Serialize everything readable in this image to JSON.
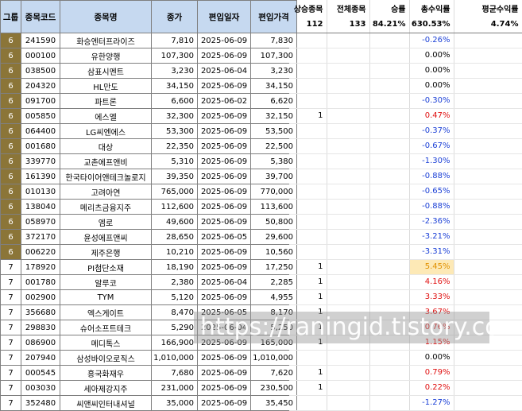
{
  "headers": [
    "그룹",
    "종목코드",
    "종목명",
    "종가",
    "편입일자",
    "편입가격"
  ],
  "rows": [
    {
      "group": "6",
      "code": "241590",
      "name": "화승엔터프라이즈",
      "close": "7,810",
      "date": "2025-06-09",
      "price": "7,830"
    },
    {
      "group": "6",
      "code": "000100",
      "name": "유한양행",
      "close": "107,300",
      "date": "2025-06-09",
      "price": "107,300"
    },
    {
      "group": "6",
      "code": "038500",
      "name": "삼표시멘트",
      "close": "3,230",
      "date": "2025-06-04",
      "price": "3,230"
    },
    {
      "group": "6",
      "code": "204320",
      "name": "HL만도",
      "close": "34,150",
      "date": "2025-06-09",
      "price": "34,150"
    },
    {
      "group": "6",
      "code": "091700",
      "name": "파트론",
      "close": "6,600",
      "date": "2025-06-02",
      "price": "6,620"
    },
    {
      "group": "6",
      "code": "005850",
      "name": "에스엘",
      "close": "32,300",
      "date": "2025-06-09",
      "price": "32,150"
    },
    {
      "group": "6",
      "code": "064400",
      "name": "LG씨엔에스",
      "close": "53,300",
      "date": "2025-06-09",
      "price": "53,500"
    },
    {
      "group": "6",
      "code": "001680",
      "name": "대상",
      "close": "22,350",
      "date": "2025-06-09",
      "price": "22,500"
    },
    {
      "group": "6",
      "code": "339770",
      "name": "교촌에프앤비",
      "close": "5,310",
      "date": "2025-06-09",
      "price": "5,380"
    },
    {
      "group": "6",
      "code": "161390",
      "name": "한국타이어앤테크놀로지",
      "close": "39,350",
      "date": "2025-06-09",
      "price": "39,700"
    },
    {
      "group": "6",
      "code": "010130",
      "name": "고려아연",
      "close": "765,000",
      "date": "2025-06-09",
      "price": "770,000"
    },
    {
      "group": "6",
      "code": "138040",
      "name": "메리츠금융지주",
      "close": "112,600",
      "date": "2025-06-09",
      "price": "113,600"
    },
    {
      "group": "6",
      "code": "058970",
      "name": "엠로",
      "close": "49,600",
      "date": "2025-06-09",
      "price": "50,800"
    },
    {
      "group": "6",
      "code": "372170",
      "name": "윤성에프앤씨",
      "close": "28,650",
      "date": "2025-06-05",
      "price": "29,600"
    },
    {
      "group": "6",
      "code": "006220",
      "name": "제주은행",
      "close": "10,210",
      "date": "2025-06-09",
      "price": "10,560"
    },
    {
      "group": "7",
      "code": "178920",
      "name": "PI첨단소재",
      "close": "18,190",
      "date": "2025-06-09",
      "price": "17,250"
    },
    {
      "group": "7",
      "code": "001780",
      "name": "알루코",
      "close": "2,380",
      "date": "2025-06-04",
      "price": "2,285"
    },
    {
      "group": "7",
      "code": "002900",
      "name": "TYM",
      "close": "5,120",
      "date": "2025-06-09",
      "price": "4,955"
    },
    {
      "group": "7",
      "code": "356680",
      "name": "엑스게이트",
      "close": "8,470",
      "date": "2025-06-05",
      "price": "8,170"
    },
    {
      "group": "7",
      "code": "298830",
      "name": "슈어소프트테크",
      "close": "5,290",
      "date": "2025-06-04",
      "price": "5,250"
    },
    {
      "group": "7",
      "code": "086900",
      "name": "메디톡스",
      "close": "166,900",
      "date": "2025-06-09",
      "price": "165,000"
    },
    {
      "group": "7",
      "code": "207940",
      "name": "삼성바이오로직스",
      "close": "1,010,000",
      "date": "2025-06-09",
      "price": "1,010,000"
    },
    {
      "group": "7",
      "code": "000545",
      "name": "흥국화재우",
      "close": "7,680",
      "date": "2025-06-09",
      "price": "7,620"
    },
    {
      "group": "7",
      "code": "003030",
      "name": "세아제강지주",
      "close": "231,000",
      "date": "2025-06-09",
      "price": "230,500"
    },
    {
      "group": "7",
      "code": "352480",
      "name": "씨앤씨인터내셔널",
      "close": "35,000",
      "date": "2025-06-09",
      "price": "35,450"
    }
  ],
  "stats": {
    "headers": [
      "상승종목",
      "전체종목",
      "승률",
      "총수익률",
      "평균수익률"
    ],
    "values": [
      "112",
      "133",
      "84.21%",
      "630.53%",
      "4.74%"
    ]
  },
  "side": [
    {
      "rise": "",
      "ret": "-0.26%",
      "sign": "neg"
    },
    {
      "rise": "",
      "ret": "0.00%",
      "sign": "zero"
    },
    {
      "rise": "",
      "ret": "0.00%",
      "sign": "zero"
    },
    {
      "rise": "",
      "ret": "0.00%",
      "sign": "zero"
    },
    {
      "rise": "",
      "ret": "-0.30%",
      "sign": "neg"
    },
    {
      "rise": "1",
      "ret": "0.47%",
      "sign": "pos"
    },
    {
      "rise": "",
      "ret": "-0.37%",
      "sign": "neg"
    },
    {
      "rise": "",
      "ret": "-0.67%",
      "sign": "neg"
    },
    {
      "rise": "",
      "ret": "-1.30%",
      "sign": "neg"
    },
    {
      "rise": "",
      "ret": "-0.88%",
      "sign": "neg"
    },
    {
      "rise": "",
      "ret": "-0.65%",
      "sign": "neg"
    },
    {
      "rise": "",
      "ret": "-0.88%",
      "sign": "neg"
    },
    {
      "rise": "",
      "ret": "-2.36%",
      "sign": "neg"
    },
    {
      "rise": "",
      "ret": "-3.21%",
      "sign": "neg"
    },
    {
      "rise": "",
      "ret": "-3.31%",
      "sign": "neg"
    },
    {
      "rise": "1",
      "ret": "5.45%",
      "sign": "hl"
    },
    {
      "rise": "1",
      "ret": "4.16%",
      "sign": "pos"
    },
    {
      "rise": "1",
      "ret": "3.33%",
      "sign": "pos"
    },
    {
      "rise": "1",
      "ret": "3.67%",
      "sign": "pos"
    },
    {
      "rise": "1",
      "ret": "0.76%",
      "sign": "pos"
    },
    {
      "rise": "1",
      "ret": "1.15%",
      "sign": "pos"
    },
    {
      "rise": "",
      "ret": "0.00%",
      "sign": "zero"
    },
    {
      "rise": "1",
      "ret": "0.79%",
      "sign": "pos"
    },
    {
      "rise": "1",
      "ret": "0.22%",
      "sign": "pos"
    },
    {
      "rise": "",
      "ret": "-1.27%",
      "sign": "neg"
    }
  ],
  "watermark": "https://raningid.tistory.com",
  "colors": {
    "group6": "#8b7538",
    "header": "#c6d9f0",
    "negative": "#1a3fd6",
    "positive": "#e01010",
    "highlight": "#fde9b6"
  }
}
